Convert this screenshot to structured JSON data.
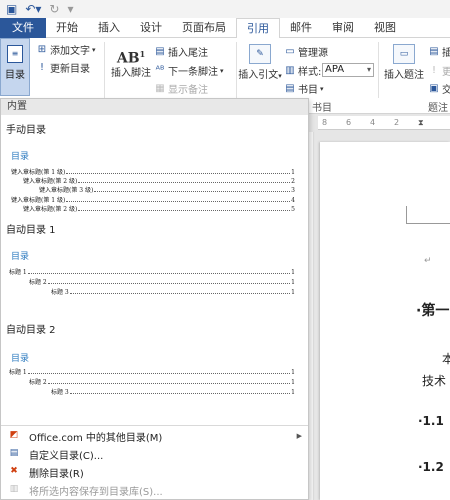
{
  "qat": {
    "save_icon": "save-icon",
    "undo_icon": "undo-icon",
    "redo_icon": "redo-icon"
  },
  "tabs": [
    {
      "label": "文件"
    },
    {
      "label": "开始"
    },
    {
      "label": "插入"
    },
    {
      "label": "设计"
    },
    {
      "label": "页面布局"
    },
    {
      "label": "引用"
    },
    {
      "label": "邮件"
    },
    {
      "label": "审阅"
    },
    {
      "label": "视图"
    }
  ],
  "ribbon": {
    "toc_button": "目录",
    "add_text": "添加文字",
    "update_toc": "更新目录",
    "insert_footnote": "插入脚注",
    "insert_endnote": "插入尾注",
    "next_footnote": "下一条脚注",
    "show_notes": "显示备注",
    "insert_citation": "插入引文",
    "manage_sources": "管理源",
    "style_label": "样式:",
    "style_value": "APA",
    "bibliography": "书目",
    "bib_group_label": "书目",
    "insert_caption": "插入题注",
    "caption_group_label": "题注",
    "caption_small_1": "插",
    "caption_small_2": "更",
    "caption_small_3": "交"
  },
  "panel": {
    "header": "内置",
    "sections": [
      {
        "label": "手动目录",
        "toc_title": "目录",
        "lines": [
          {
            "text": "键入章标题(第 1 级)",
            "num": "1",
            "level": 1
          },
          {
            "text": "键入章标题(第 2 级)",
            "num": "2",
            "level": 2
          },
          {
            "text": "键入章标题(第 3 级)",
            "num": "3",
            "level": 3
          },
          {
            "text": "键入章标题(第 1 级)",
            "num": "4",
            "level": 1
          },
          {
            "text": "键入章标题(第 2 级)",
            "num": "5",
            "level": 2
          }
        ]
      },
      {
        "label": "自动目录 1",
        "toc_title": "目录",
        "lines": [
          {
            "text": "标题 1",
            "num": "1",
            "level": 1
          },
          {
            "text": "标题 2",
            "num": "1",
            "level": 2
          },
          {
            "text": "标题 3",
            "num": "1",
            "level": 3
          }
        ]
      },
      {
        "label": "自动目录 2",
        "toc_title": "目录",
        "lines": [
          {
            "text": "标题 1",
            "num": "1",
            "level": 1
          },
          {
            "text": "标题 2",
            "num": "1",
            "level": 2
          },
          {
            "text": "标题 3",
            "num": "1",
            "level": 3
          }
        ]
      }
    ],
    "menu": [
      {
        "label": "Office.com 中的其他目录(M)",
        "icon": "office-icon",
        "submenu": true,
        "disabled": false
      },
      {
        "label": "自定义目录(C)...",
        "icon": "custom-toc-icon",
        "submenu": false,
        "disabled": false
      },
      {
        "label": "删除目录(R)",
        "icon": "delete-toc-icon",
        "submenu": false,
        "disabled": false
      },
      {
        "label": "将所选内容保存到目录库(S)...",
        "icon": "save-selection-icon",
        "submenu": false,
        "disabled": true
      }
    ]
  },
  "document": {
    "ruler_marks": [
      "8",
      "6",
      "4",
      "2"
    ],
    "para_mark": "↵",
    "heading1": "·第一",
    "body_line1": "本",
    "body_line2": "技术",
    "heading_1_1": "·1.1",
    "heading_1_2": "·1.2"
  }
}
